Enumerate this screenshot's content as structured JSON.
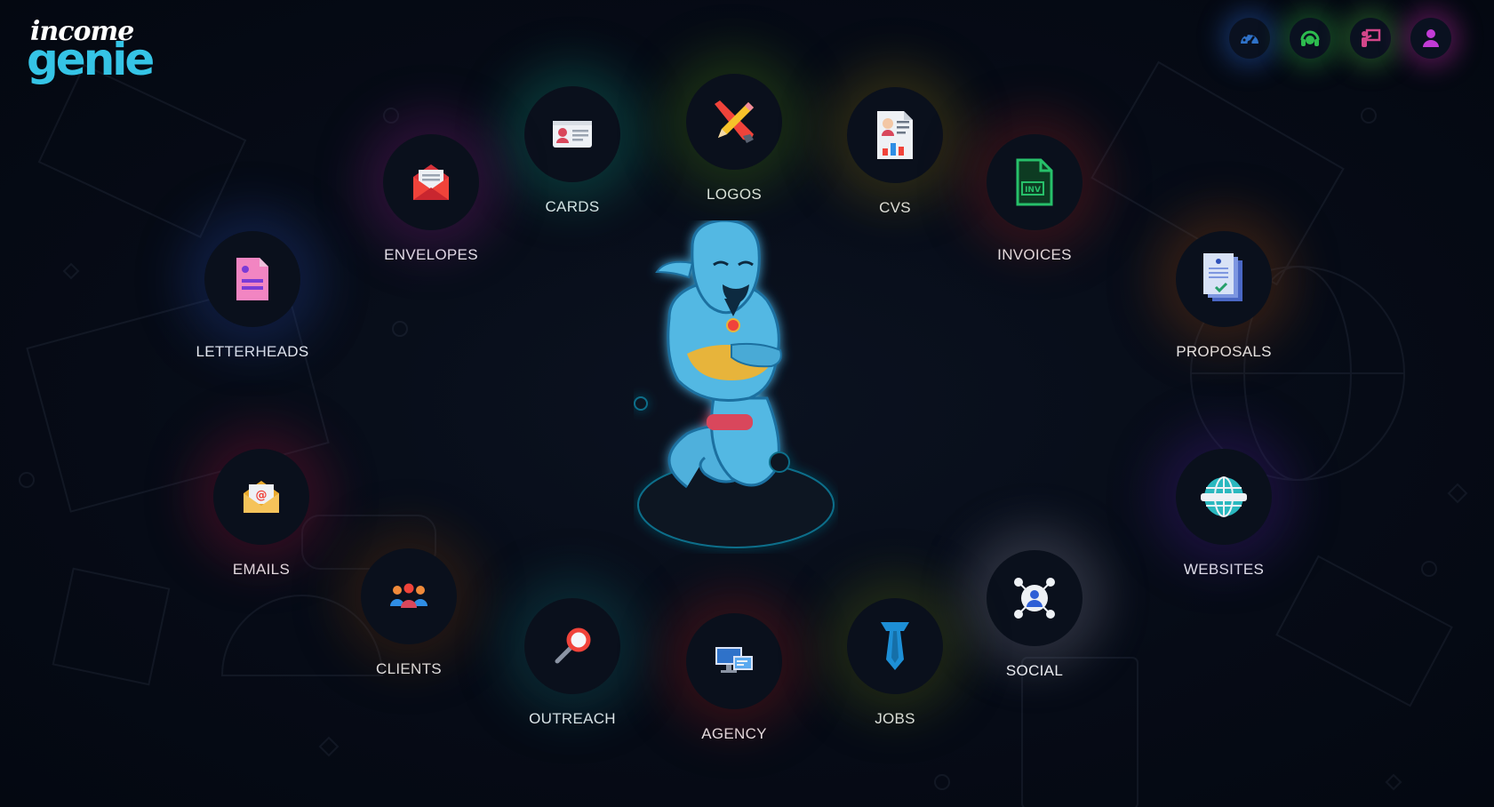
{
  "brand": {
    "line1": "income",
    "line2": "genie",
    "color": "#35c4e6"
  },
  "top_icons": [
    {
      "name": "dashboard-icon",
      "glow": "#1e4f9e"
    },
    {
      "name": "support-headset-icon",
      "glow": "#1e7a2e"
    },
    {
      "name": "training-presentation-icon",
      "glow": "#2f7a2e"
    },
    {
      "name": "user-profile-icon",
      "glow": "#8a1f7a"
    }
  ],
  "nodes": [
    {
      "key": "cards",
      "label": "CARDS",
      "icon": "id-card-icon",
      "glow": "#0f7b6a"
    },
    {
      "key": "logos",
      "label": "LOGOS",
      "icon": "pencil-icon",
      "glow": "#3d6b12"
    },
    {
      "key": "cvs",
      "label": "CVS",
      "icon": "resume-icon",
      "glow": "#6b5d12"
    },
    {
      "key": "envelopes",
      "label": "ENVELOPES",
      "icon": "envelope-icon",
      "glow": "#6a1b6b"
    },
    {
      "key": "invoices",
      "label": "INVOICES",
      "icon": "invoice-file-icon",
      "glow": "#7a1d1d"
    },
    {
      "key": "letterheads",
      "label": "LETTERHEADS",
      "icon": "document-icon",
      "glow": "#1f3b8a"
    },
    {
      "key": "proposals",
      "label": "PROPOSALS",
      "icon": "proposal-icon",
      "glow": "#7a3d12"
    },
    {
      "key": "emails",
      "label": "EMAILS",
      "icon": "email-icon",
      "glow": "#7a1230"
    },
    {
      "key": "websites",
      "label": "WEBSITES",
      "icon": "globe-icon",
      "glow": "#3c1a7a"
    },
    {
      "key": "clients",
      "label": "CLIENTS",
      "icon": "people-icon",
      "glow": "#5a2e0c"
    },
    {
      "key": "social",
      "label": "SOCIAL",
      "icon": "social-network-icon",
      "glow": "#6a6a7a"
    },
    {
      "key": "outreach",
      "label": "OUTREACH",
      "icon": "magnifier-icon",
      "glow": "#0e5a5e"
    },
    {
      "key": "agency",
      "label": "AGENCY",
      "icon": "monitors-icon",
      "glow": "#7a1616"
    },
    {
      "key": "jobs",
      "label": "JOBS",
      "icon": "tie-icon",
      "glow": "#4a5a12"
    }
  ],
  "mascot": {
    "name": "genie-mascot"
  }
}
